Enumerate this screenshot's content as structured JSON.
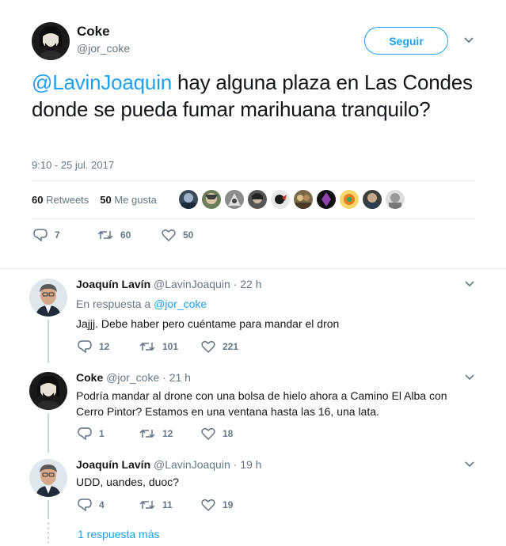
{
  "main_tweet": {
    "name": "Coke",
    "handle": "@jor_coke",
    "follow_label": "Seguir",
    "mention": "@LavinJoaquin",
    "text": " hay alguna plaza en Las Condes donde se pueda fumar marihuana tranquilo?",
    "timestamp": "9:10 - 25 jul. 2017",
    "retweets_count": "60",
    "retweets_label": "Retweets",
    "likes_count": "50",
    "likes_label": "Me gusta",
    "actions": {
      "replies": "7",
      "retweets": "60",
      "likes": "50"
    }
  },
  "replies": [
    {
      "name": "Joaquín Lavín",
      "handle": "@LavinJoaquin",
      "time": "22 h",
      "reply_to_label": "En respuesta a",
      "reply_to_handle": "@jor_coke",
      "text": "Jajjj. Debe haber pero cuéntame para mandar el dron",
      "actions": {
        "replies": "12",
        "retweets": "101",
        "likes": "221"
      }
    },
    {
      "name": "Coke",
      "handle": "@jor_coke",
      "time": "21 h",
      "text_line1": "Podría mandar al drone con una bolsa de hielo ahora a Camino El Alba con",
      "text_line2": "Cerro Pintor? Estamos en una ventana hasta las 16, una lata.",
      "actions": {
        "replies": "1",
        "retweets": "12",
        "likes": "18"
      }
    },
    {
      "name": "Joaquín Lavín",
      "handle": "@LavinJoaquin",
      "time": "19 h",
      "text": "UDD, uandes, duoc?",
      "actions": {
        "replies": "4",
        "retweets": "11",
        "likes": "19"
      }
    }
  ],
  "more_replies_label": "1 respuesta más",
  "colors": {
    "accent": "#1da1f2",
    "muted": "#657786",
    "text": "#14171a",
    "border": "#e6ecf0"
  },
  "icons": [
    "reply-icon",
    "retweet-icon",
    "like-icon",
    "chevron-down-icon"
  ]
}
